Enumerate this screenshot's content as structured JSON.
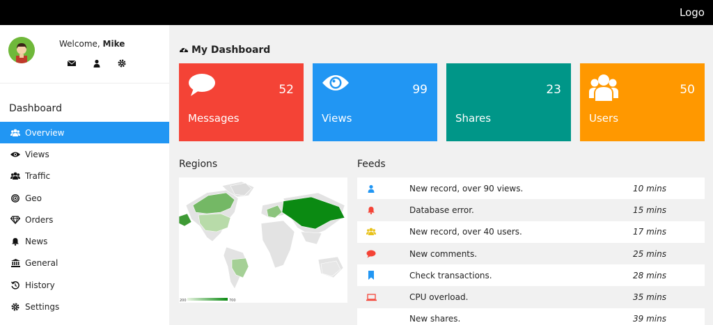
{
  "topbar": {
    "logo": "Logo"
  },
  "user": {
    "welcome_prefix": "Welcome, ",
    "name": "Mike"
  },
  "sidebar": {
    "heading": "Dashboard",
    "items": [
      {
        "label": "Overview",
        "icon": "users-icon"
      },
      {
        "label": "Views",
        "icon": "eye-icon"
      },
      {
        "label": "Traffic",
        "icon": "users-icon"
      },
      {
        "label": "Geo",
        "icon": "bullseye-icon"
      },
      {
        "label": "Orders",
        "icon": "diamond-icon"
      },
      {
        "label": "News",
        "icon": "bell-icon"
      },
      {
        "label": "General",
        "icon": "bank-icon"
      },
      {
        "label": "History",
        "icon": "history-icon"
      },
      {
        "label": "Settings",
        "icon": "gear-icon"
      }
    ]
  },
  "main": {
    "title": "My Dashboard"
  },
  "cards": [
    {
      "label": "Messages",
      "value": "52",
      "color": "#f44336",
      "icon": "comment-icon"
    },
    {
      "label": "Views",
      "value": "99",
      "color": "#2196f3",
      "icon": "eye-icon"
    },
    {
      "label": "Shares",
      "value": "23",
      "color": "#009688",
      "icon": "share-icon"
    },
    {
      "label": "Users",
      "value": "50",
      "color": "#ff9800",
      "icon": "users-icon"
    }
  ],
  "regions": {
    "title": "Regions",
    "legend_min": "200",
    "legend_max": "700"
  },
  "feeds": {
    "title": "Feeds",
    "rows": [
      {
        "text": "New record, over 90 views.",
        "time": "10 mins",
        "icon": "user-icon",
        "color": "#2196f3"
      },
      {
        "text": "Database error.",
        "time": "15 mins",
        "icon": "bell-icon",
        "color": "#f44336"
      },
      {
        "text": "New record, over 40 users.",
        "time": "17 mins",
        "icon": "users-icon",
        "color": "#e8c21c"
      },
      {
        "text": "New comments.",
        "time": "25 mins",
        "icon": "comment-icon",
        "color": "#f44336"
      },
      {
        "text": "Check transactions.",
        "time": "28 mins",
        "icon": "bookmark-icon",
        "color": "#2196f3"
      },
      {
        "text": "CPU overload.",
        "time": "35 mins",
        "icon": "laptop-icon",
        "color": "#f44336"
      },
      {
        "text": "New shares.",
        "time": "39 mins",
        "icon": "share-icon",
        "color": "#009688"
      }
    ]
  }
}
